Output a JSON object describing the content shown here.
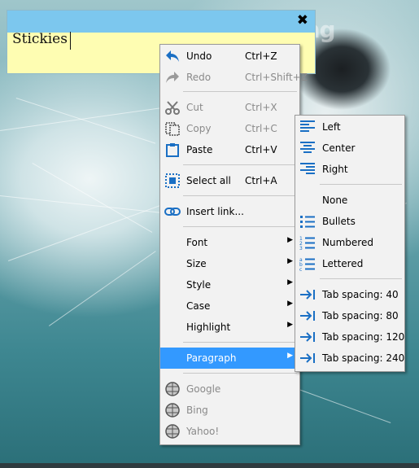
{
  "note": {
    "text": "Stickies",
    "close_glyph": "✖"
  },
  "watermark": {
    "text": "uantrimang"
  },
  "context_menu": {
    "undo": {
      "label": "Undo",
      "shortcut": "Ctrl+Z"
    },
    "redo": {
      "label": "Redo",
      "shortcut": "Ctrl+Shift+Z"
    },
    "cut": {
      "label": "Cut",
      "shortcut": "Ctrl+X"
    },
    "copy": {
      "label": "Copy",
      "shortcut": "Ctrl+C"
    },
    "paste": {
      "label": "Paste",
      "shortcut": "Ctrl+V"
    },
    "select_all": {
      "label": "Select all",
      "shortcut": "Ctrl+A"
    },
    "insert_link": {
      "label": "Insert link..."
    },
    "font": {
      "label": "Font"
    },
    "size": {
      "label": "Size"
    },
    "style": {
      "label": "Style"
    },
    "case": {
      "label": "Case"
    },
    "highlight": {
      "label": "Highlight"
    },
    "paragraph": {
      "label": "Paragraph"
    },
    "google": {
      "label": "Google"
    },
    "bing": {
      "label": "Bing"
    },
    "yahoo": {
      "label": "Yahoo!"
    },
    "submenu_arrow": "▶"
  },
  "paragraph_submenu": {
    "left": "Left",
    "center": "Center",
    "right": "Right",
    "none": "None",
    "bullets": "Bullets",
    "numbered": "Numbered",
    "lettered": "Lettered",
    "tab40": "Tab spacing: 40",
    "tab80": "Tab spacing: 80",
    "tab120": "Tab spacing: 120",
    "tab240": "Tab spacing: 240"
  },
  "colors": {
    "accent_blue": "#1a6fc4",
    "highlight": "#3399ff",
    "note_title": "#7cc7ee",
    "note_body": "#fefdb2"
  }
}
